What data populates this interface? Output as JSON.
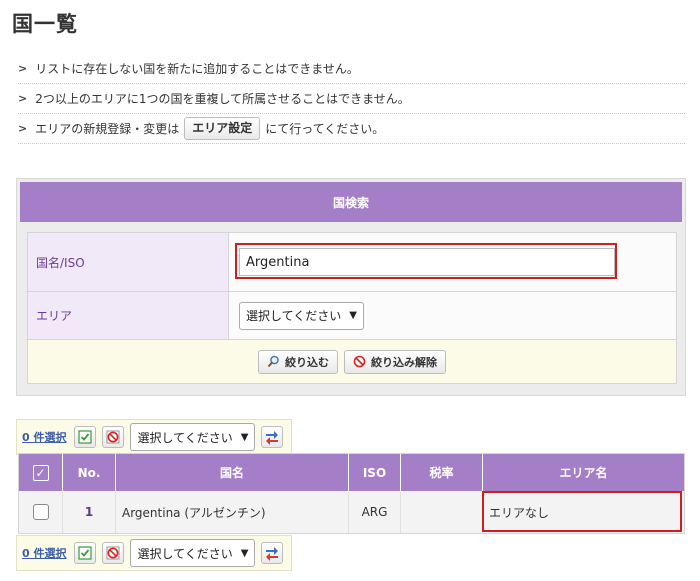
{
  "page": {
    "title": "国一覧"
  },
  "notes": [
    {
      "text": "リストに存在しない国を新たに追加することはできません。"
    },
    {
      "text": "2つ以上のエリアに1つの国を重複して所属させることはできません。"
    },
    {
      "prefix": "エリアの新規登録・変更は",
      "button": "エリア設定",
      "suffix": "にて行ってください。"
    }
  ],
  "search": {
    "header": "国検索",
    "name_label": "国名/ISO",
    "name_value": "Argentina",
    "area_label": "エリア",
    "area_select": "選択してください",
    "filter_button": "絞り込む",
    "clear_button": "絞り込み解除"
  },
  "toolbar": {
    "selected_count": "0 件選択",
    "action_select": "選択してください"
  },
  "results": {
    "columns": [
      "No.",
      "国名",
      "ISO",
      "税率",
      "エリア名"
    ],
    "rows": [
      {
        "no": "1",
        "name": "Argentina (アルゼンチン)",
        "iso": "ARG",
        "tax": "",
        "area": "エリアなし"
      }
    ]
  },
  "colors": {
    "accent": "#a47fc8",
    "label_bg": "#f1e8f8",
    "highlight": "#cc1f1f",
    "filter_bg": "#fcfbe8"
  }
}
